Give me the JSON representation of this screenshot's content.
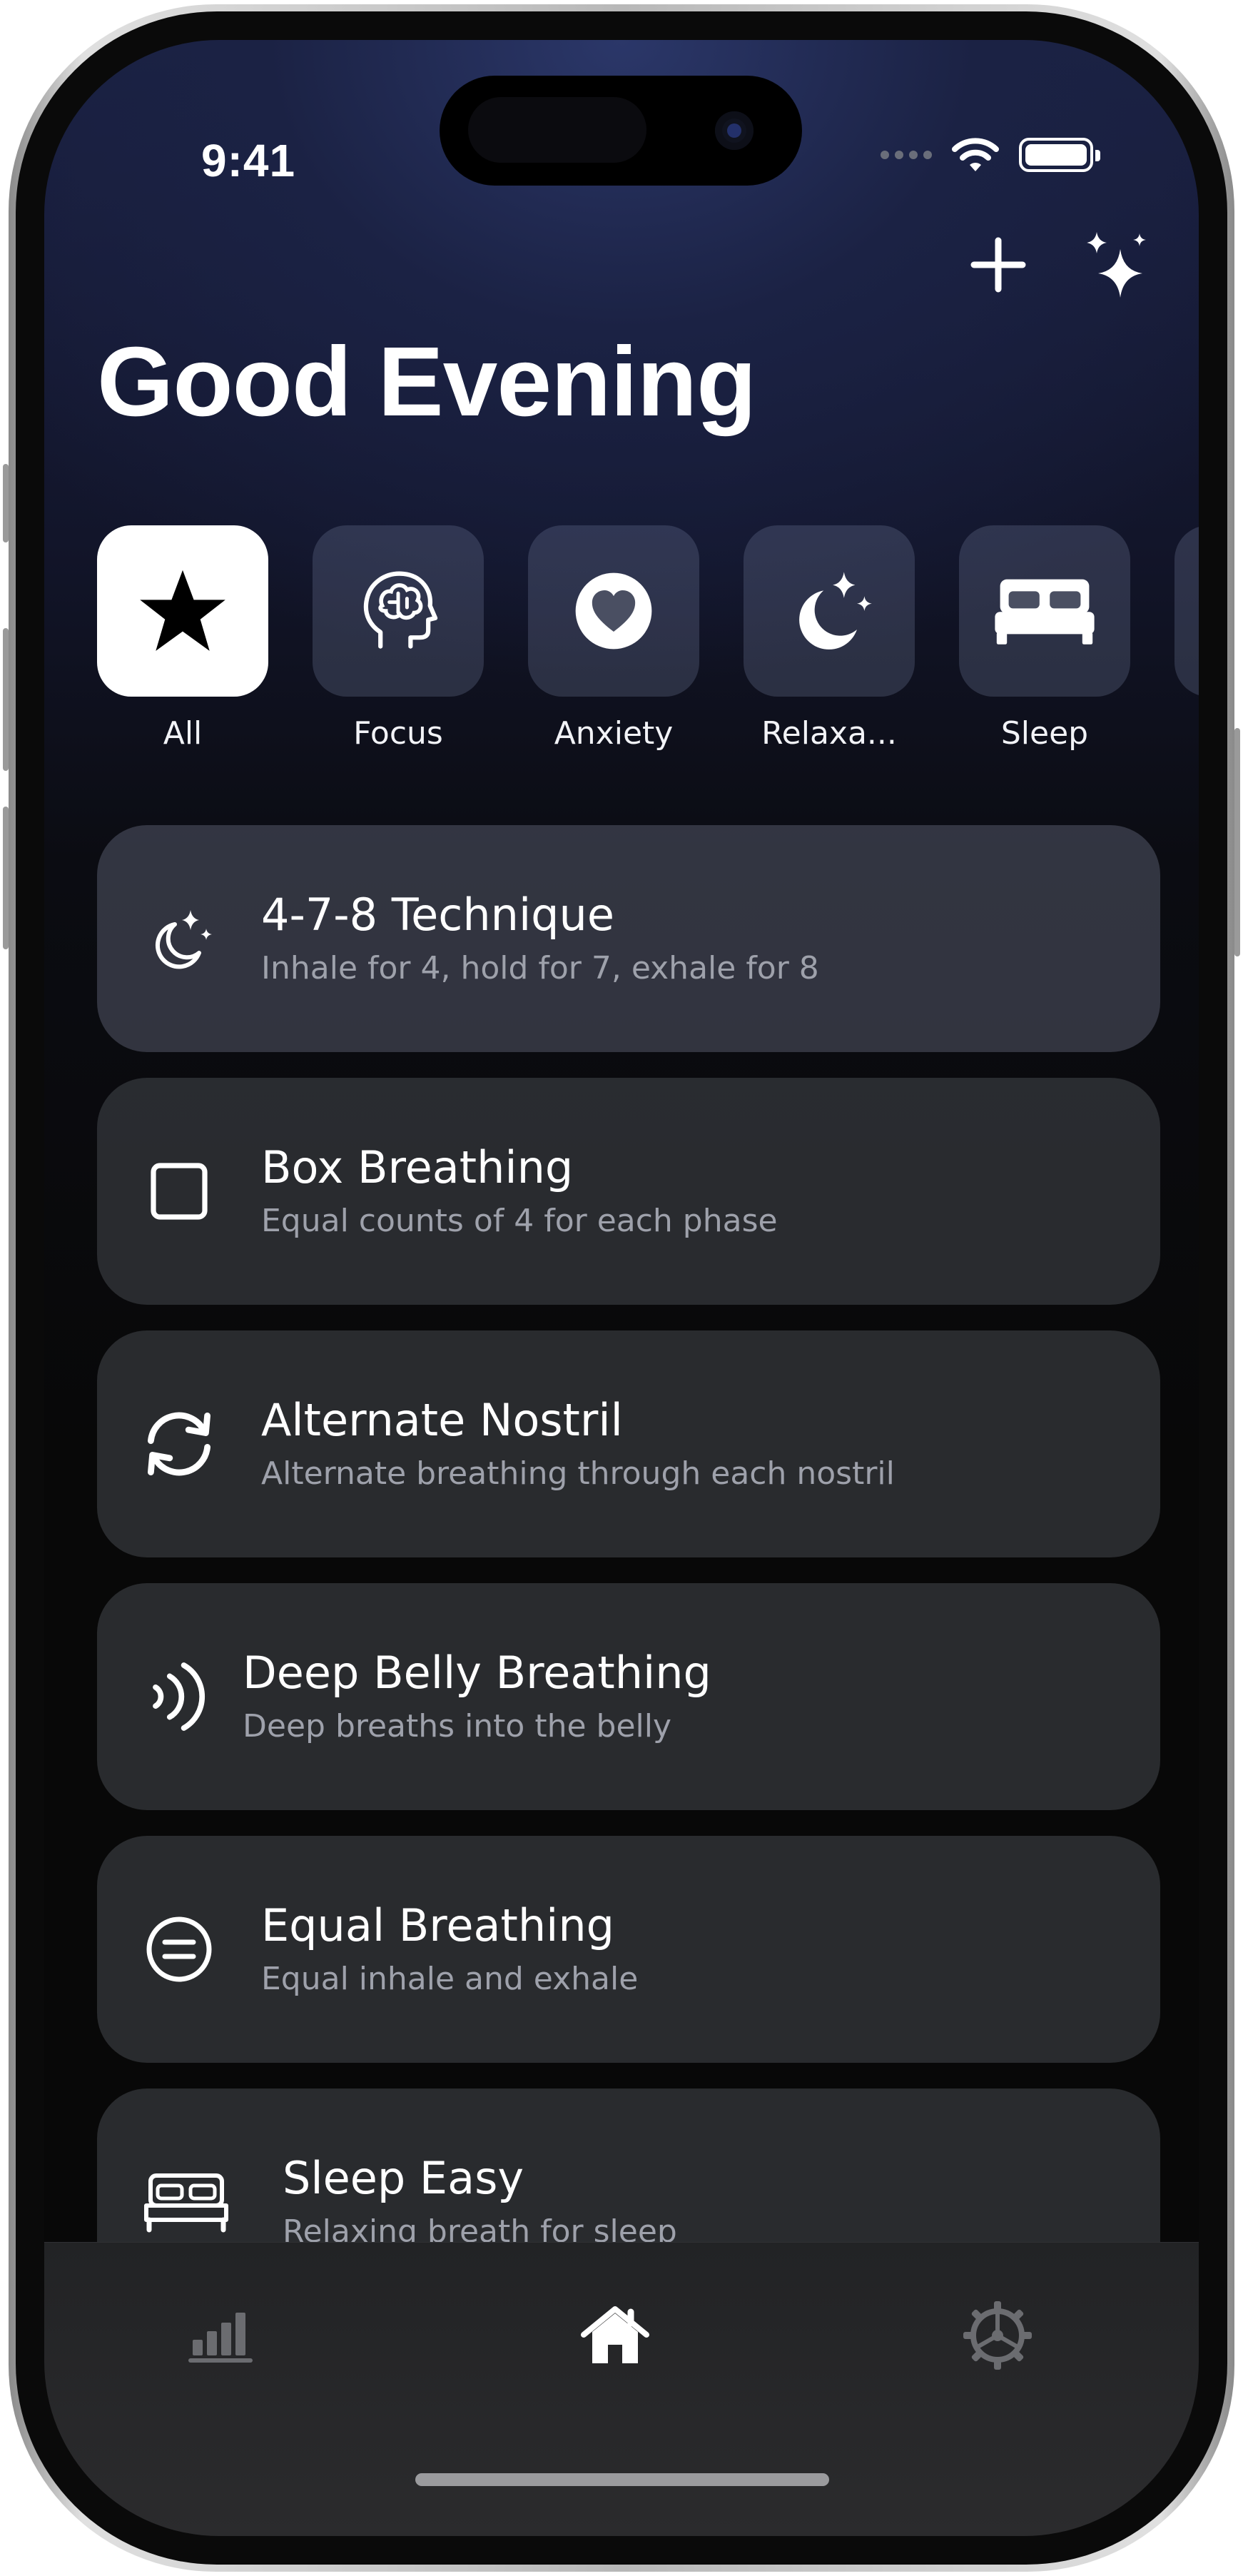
{
  "status": {
    "time": "9:41"
  },
  "header": {
    "greeting": "Good Evening",
    "add_icon": "plus-icon",
    "sparkle_icon": "sparkles-icon"
  },
  "categories": [
    {
      "label": "All",
      "icon": "star-icon",
      "active": true
    },
    {
      "label": "Focus",
      "icon": "brain-head-icon",
      "active": false
    },
    {
      "label": "Anxiety",
      "icon": "heart-circle-icon",
      "active": false
    },
    {
      "label": "Relaxa...",
      "icon": "moon-stars-icon",
      "active": false
    },
    {
      "label": "Sleep",
      "icon": "bed-icon",
      "active": false
    }
  ],
  "exercises": [
    {
      "title": "4-7-8 Technique",
      "subtitle": "Inhale for 4, hold for 7, exhale for 8",
      "icon": "moon-stars-icon"
    },
    {
      "title": "Box Breathing",
      "subtitle": "Equal counts of 4 for each phase",
      "icon": "square-icon"
    },
    {
      "title": "Alternate Nostril",
      "subtitle": "Alternate breathing through each nostril",
      "icon": "arrows-cycle-icon"
    },
    {
      "title": "Deep Belly Breathing",
      "subtitle": "Deep breaths into the belly",
      "icon": "waves-icon"
    },
    {
      "title": "Equal Breathing",
      "subtitle": "Equal inhale and exhale",
      "icon": "equal-circle-icon"
    },
    {
      "title": "Sleep Easy",
      "subtitle": "Relaxing breath for sleep",
      "icon": "bed-icon"
    }
  ],
  "tabbar": {
    "tabs": [
      {
        "name": "stats",
        "icon": "chart-bars-icon",
        "active": false
      },
      {
        "name": "home",
        "icon": "house-icon",
        "active": true
      },
      {
        "name": "settings",
        "icon": "gear-icon",
        "active": false
      }
    ]
  },
  "colors": {
    "accent": "#ffffff",
    "subtitle": "#9ea1ab",
    "inactive_tab": "#6b6c70"
  }
}
